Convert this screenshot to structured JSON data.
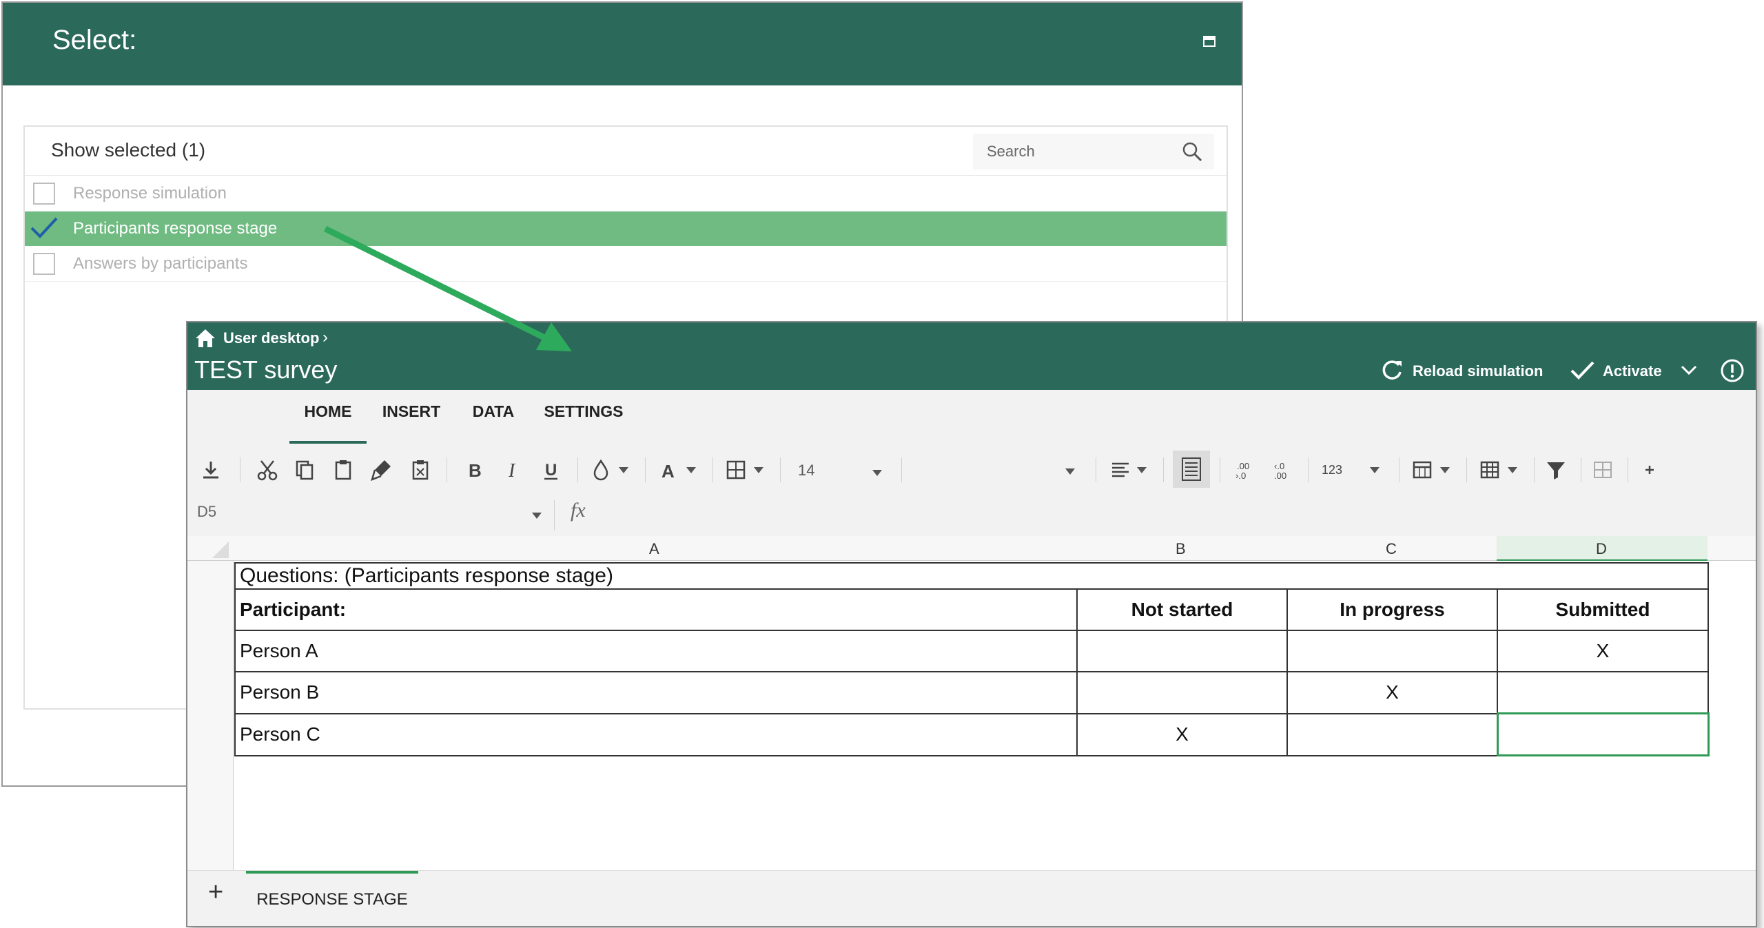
{
  "select_dialog": {
    "title": "Select:",
    "show_selected_label": "Show selected (1)",
    "search_placeholder": "Search",
    "items": [
      {
        "label": "Response simulation",
        "checked": false
      },
      {
        "label": "Participants response stage",
        "checked": true
      },
      {
        "label": "Answers by participants",
        "checked": false
      }
    ]
  },
  "spreadsheet": {
    "breadcrumb": "User desktop",
    "title": "TEST survey",
    "reload_label": "Reload simulation",
    "activate_label": "Activate",
    "ribbon_tabs": [
      "HOME",
      "INSERT",
      "DATA",
      "SETTINGS"
    ],
    "active_tab": "HOME",
    "font_size": "14",
    "number_format_label": "123",
    "cell_reference": "D5",
    "columns": [
      "A",
      "B",
      "C",
      "D"
    ],
    "sheet_title": "Questions: (Participants response stage)",
    "table_headers": [
      "Participant:",
      "Not started",
      "In progress",
      "Submitted"
    ],
    "rows": [
      {
        "participant": "Person A",
        "not_started": "",
        "in_progress": "",
        "submitted": "X"
      },
      {
        "participant": "Person B",
        "not_started": "",
        "in_progress": "X",
        "submitted": ""
      },
      {
        "participant": "Person C",
        "not_started": "X",
        "in_progress": "",
        "submitted": ""
      }
    ],
    "sheet_tab": "RESPONSE STAGE"
  },
  "colors": {
    "header_green": "#2b6a5b",
    "selected_row_green": "#6fbb82",
    "arrow_green": "#2eaa5c",
    "active_cell_border": "#2e9a55"
  }
}
